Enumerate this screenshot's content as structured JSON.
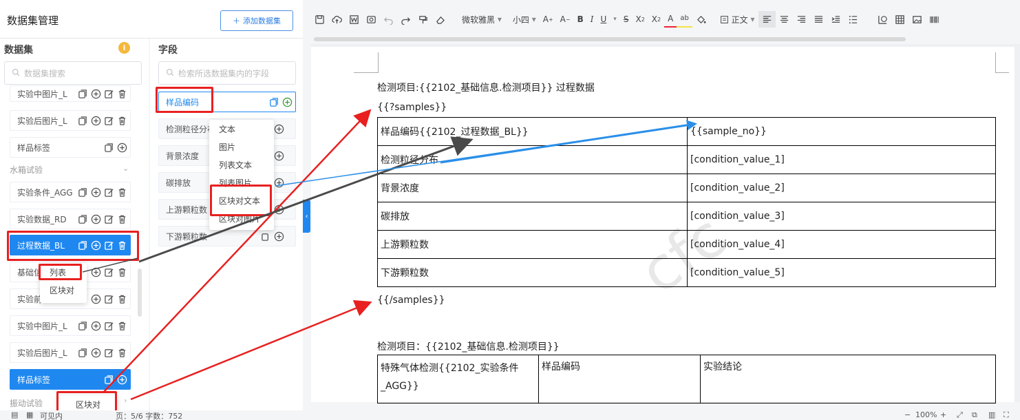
{
  "app": {
    "title": "数据集管理",
    "add_button": "添加数据集"
  },
  "dataset_panel": {
    "title": "数据集",
    "search_placeholder": "数据集搜索",
    "items_top": [
      {
        "label": "实验中图片_L"
      },
      {
        "label": "实验后图片_L"
      },
      {
        "label": "样品标签"
      }
    ],
    "group_water": "水箱试验",
    "items_group": [
      {
        "label": "实验条件_AGG"
      },
      {
        "label": "实验数据_RD"
      },
      {
        "label": "过程数据_BL"
      },
      {
        "label": "基础信"
      },
      {
        "label": "实验前"
      },
      {
        "label": "实验中图片_L"
      },
      {
        "label": "实验后图片_L"
      },
      {
        "label": "样品标签"
      }
    ],
    "group_vibration": "振动试验"
  },
  "field_panel": {
    "title": "字段",
    "search_placeholder": "检索所选数据集内的字段",
    "items": [
      {
        "label": "样品编码"
      },
      {
        "label": "检测粒径分布"
      },
      {
        "label": "背景浓度"
      },
      {
        "label": "碳排放"
      },
      {
        "label": "上游颗粒数"
      },
      {
        "label": "下游颗粒数"
      }
    ]
  },
  "field_menu": [
    "文本",
    "图片",
    "列表文本",
    "列表图片",
    "区块对文本",
    "区块对图片"
  ],
  "dataset_menu": [
    "列表",
    "区块对"
  ],
  "vibration_menu": [
    "区块对"
  ],
  "toolbar": {
    "font_name": "微软雅黑",
    "font_size": "小四",
    "style_name": "正文"
  },
  "document": {
    "line1": "检测项目:{{2102_基础信息.检测项目}} 过程数据",
    "open_tag": "{{?samples}}",
    "table1": [
      [
        "样品编码{{2102_过程数据_BL}}",
        "{{sample_no}}"
      ],
      [
        "检测粒径分布",
        "[condition_value_1]"
      ],
      [
        "背景浓度",
        "[condition_value_2]"
      ],
      [
        "碳排放",
        "[condition_value_3]"
      ],
      [
        "上游颗粒数",
        "[condition_value_4]"
      ],
      [
        "下游颗粒数",
        "[condition_value_5]"
      ]
    ],
    "close_tag": "{{/samples}}",
    "line2": "检测项目：{{2102_基础信息.检测项目}}",
    "table2_headers": [
      "特殊气体检测{{2102_实验条件_AGG}}",
      "样品编码",
      "实验结论"
    ]
  },
  "status": {
    "mode": "可见内",
    "page_info": "页：5/6 字数：752",
    "zoom": "100%"
  },
  "colors": {
    "accent": "#1f88f0",
    "highlight": "#e82020",
    "arrow_blue": "#2a8fe8",
    "arrow_dark": "#4a4a4a"
  }
}
